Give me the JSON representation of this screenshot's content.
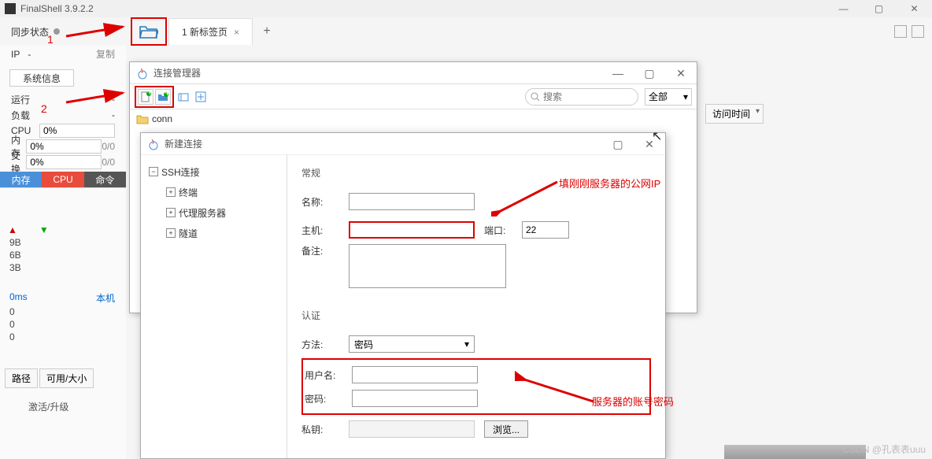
{
  "app": {
    "title": "FinalShell 3.9.2.2"
  },
  "sync": {
    "label": "同步状态"
  },
  "tabs": {
    "first": "1 新标签页"
  },
  "ip": {
    "label": "IP",
    "value": "-"
  },
  "copy": "复制",
  "sysinfo_btn": "系统信息",
  "stats": {
    "run_label": "运行",
    "run_val": "-",
    "load_label": "负载",
    "load_val": "-",
    "cpu_label": "CPU",
    "cpu_val": "0%",
    "mem_label": "内存",
    "mem_val": "0%",
    "mem_right": "0/0",
    "swap_label": "交换",
    "swap_val": "0%",
    "swap_right": "0/0"
  },
  "mini_tabs": {
    "mem": "内存",
    "cpu": "CPU",
    "cmd": "命令"
  },
  "y_labels": [
    "9B",
    "6B",
    "3B"
  ],
  "ms_row": {
    "left": "0ms",
    "right": "本机"
  },
  "zeros": [
    "0",
    "0",
    "0"
  ],
  "path_header": {
    "path": "路径",
    "avail": "可用/大小"
  },
  "activate": "激活/升级",
  "annotations": {
    "n1": "1",
    "n2": "2"
  },
  "mgr": {
    "title": "连接管理器",
    "search_placeholder": "搜索",
    "filter": "全部",
    "tree_item": "conn"
  },
  "visit_time": "访问时间",
  "newconn": {
    "title": "新建连接",
    "tree": {
      "ssh": "SSH连接",
      "term": "终端",
      "proxy": "代理服务器",
      "tunnel": "隧道"
    },
    "section_general": "常规",
    "name_label": "名称:",
    "host_label": "主机:",
    "port_label": "端口:",
    "port_val": "22",
    "remark_label": "备注:",
    "section_auth": "认证",
    "method_label": "方法:",
    "method_val": "密码",
    "user_label": "用户名:",
    "pass_label": "密码:",
    "key_label": "私钥:",
    "browse": "浏览..."
  },
  "anno": {
    "ip_hint": "填刚刚服务器的公网IP",
    "cred_hint": "服务器的账号密码"
  },
  "watermark": "CSDN @孔表表uuu"
}
